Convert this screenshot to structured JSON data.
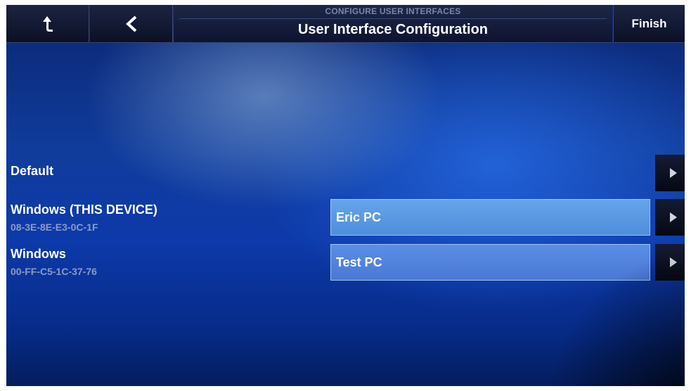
{
  "header": {
    "subtitle": "CONFIGURE USER INTERFACES",
    "title": "User Interface Configuration",
    "finish_label": "Finish",
    "home_icon": "up-arrow-icon",
    "back_icon": "chevron-left-icon"
  },
  "rows": [
    {
      "label": "Default",
      "sub": "",
      "button": ""
    },
    {
      "label": "Windows (THIS DEVICE)",
      "sub": "08-3E-8E-E3-0C-1F",
      "button": "Eric PC"
    },
    {
      "label": "Windows",
      "sub": "00-FF-C5-1C-37-76",
      "button": "Test PC"
    }
  ],
  "colors": {
    "background_top": "#0b2672",
    "background_mid": "#0d3aaa",
    "button_fill": "#5b98e6",
    "header_fill": "#141b38"
  }
}
